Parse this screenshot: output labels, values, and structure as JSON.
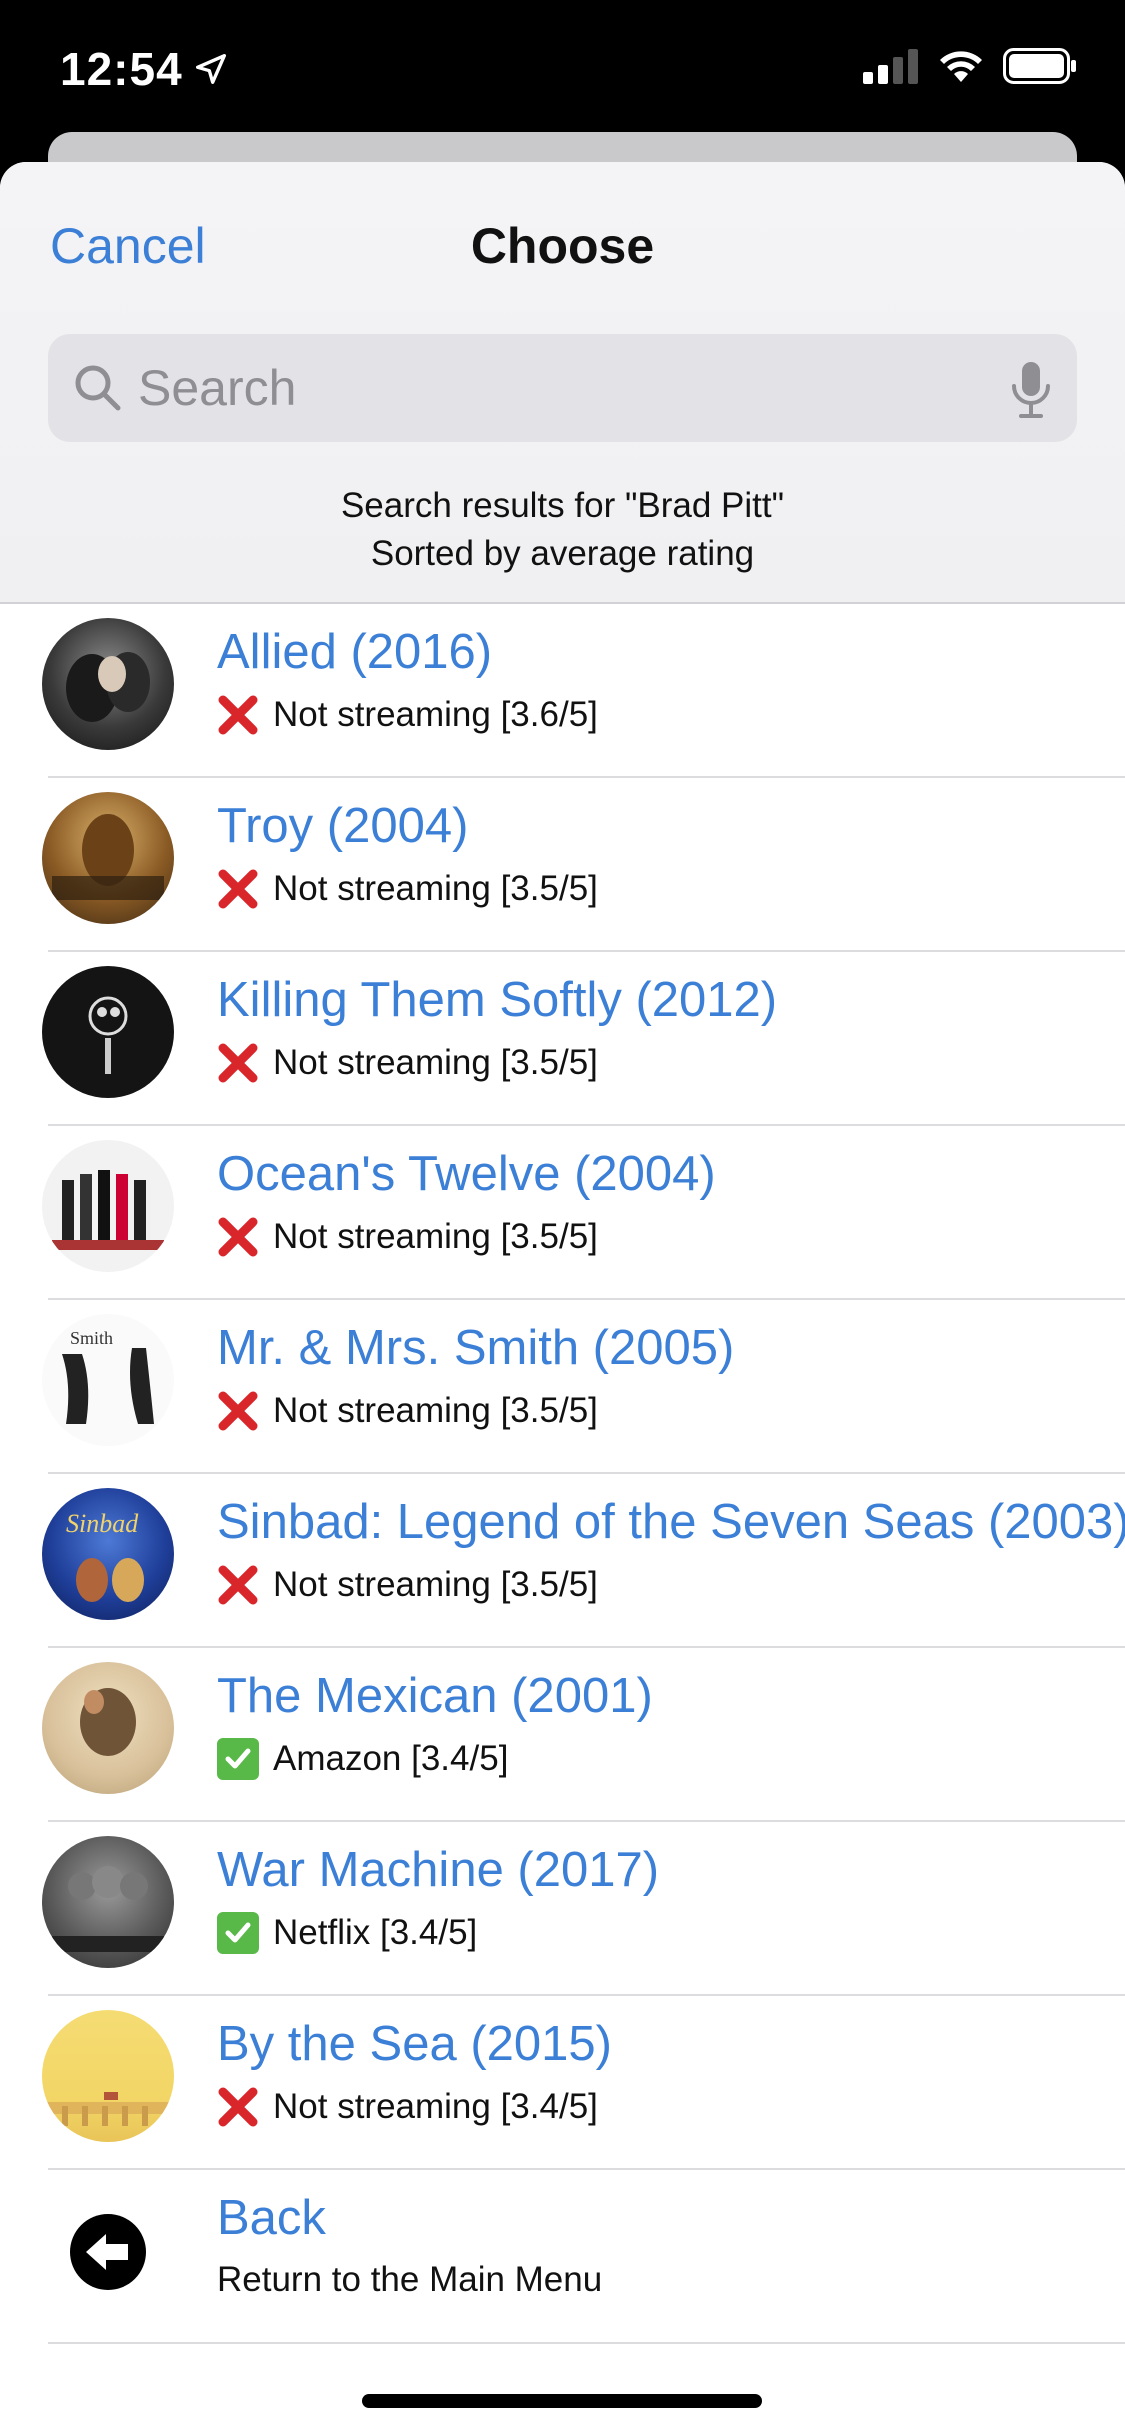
{
  "status_bar": {
    "time": "12:54"
  },
  "nav": {
    "cancel_label": "Cancel",
    "title": "Choose"
  },
  "search": {
    "placeholder": "Search",
    "value": ""
  },
  "results_info": {
    "line1": "Search results for \"Brad Pitt\"",
    "line2": "Sorted by average rating"
  },
  "colors": {
    "accent": "#3b7fd6",
    "x_mark": "#d9262b",
    "check": "#58b848"
  },
  "movies": [
    {
      "title": "Allied (2016)",
      "status": "Not streaming [3.6/5]",
      "available": false
    },
    {
      "title": "Troy (2004)",
      "status": "Not streaming [3.5/5]",
      "available": false
    },
    {
      "title": "Killing Them Softly (2012)",
      "status": "Not streaming [3.5/5]",
      "available": false
    },
    {
      "title": "Ocean's Twelve (2004)",
      "status": "Not streaming [3.5/5]",
      "available": false
    },
    {
      "title": "Mr. & Mrs. Smith (2005)",
      "status": "Not streaming [3.5/5]",
      "available": false
    },
    {
      "title": "Sinbad: Legend of the Seven Seas (2003)",
      "status": "Not streaming [3.5/5]",
      "available": false
    },
    {
      "title": "The Mexican (2001)",
      "status": "Amazon [3.4/5]",
      "available": true
    },
    {
      "title": "War Machine (2017)",
      "status": "Netflix [3.4/5]",
      "available": true
    },
    {
      "title": "By the Sea (2015)",
      "status": "Not streaming [3.4/5]",
      "available": false
    }
  ],
  "back_row": {
    "title": "Back",
    "subtitle": "Return to the Main Menu"
  }
}
